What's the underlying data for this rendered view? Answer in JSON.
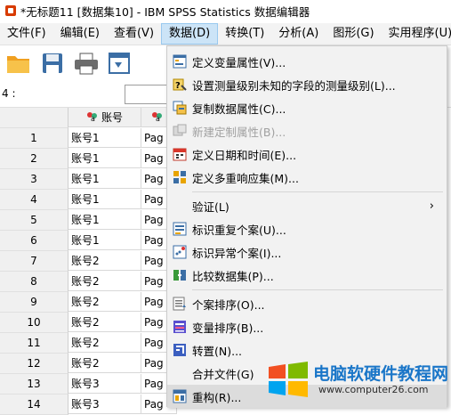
{
  "window": {
    "title": "*无标题11 [数据集10] - IBM SPSS Statistics 数据编辑器"
  },
  "menubar": {
    "items": [
      {
        "label": "文件(F)"
      },
      {
        "label": "编辑(E)"
      },
      {
        "label": "查看(V)"
      },
      {
        "label": "数据(D)"
      },
      {
        "label": "转换(T)"
      },
      {
        "label": "分析(A)"
      },
      {
        "label": "图形(G)"
      },
      {
        "label": "实用程序(U)"
      }
    ]
  },
  "varrow": {
    "label": "4 :"
  },
  "grid": {
    "columns": [
      "账号",
      "a"
    ],
    "rows": [
      {
        "num": "1",
        "c1": "账号1",
        "c2": "Pag"
      },
      {
        "num": "2",
        "c1": "账号1",
        "c2": "Pag"
      },
      {
        "num": "3",
        "c1": "账号1",
        "c2": "Pag"
      },
      {
        "num": "4",
        "c1": "账号1",
        "c2": "Pag"
      },
      {
        "num": "5",
        "c1": "账号1",
        "c2": "Pag"
      },
      {
        "num": "6",
        "c1": "账号1",
        "c2": "Pag"
      },
      {
        "num": "7",
        "c1": "账号2",
        "c2": "Pag"
      },
      {
        "num": "8",
        "c1": "账号2",
        "c2": "Pag"
      },
      {
        "num": "9",
        "c1": "账号2",
        "c2": "Pag"
      },
      {
        "num": "10",
        "c1": "账号2",
        "c2": "Pag"
      },
      {
        "num": "11",
        "c1": "账号2",
        "c2": "Pag"
      },
      {
        "num": "12",
        "c1": "账号2",
        "c2": "Pag"
      },
      {
        "num": "13",
        "c1": "账号3",
        "c2": "Pag"
      },
      {
        "num": "14",
        "c1": "账号3",
        "c2": "Pag"
      }
    ]
  },
  "dropdown": {
    "items": [
      {
        "label": "定义变量属性(V)...",
        "icon": "define-variable-properties-icon"
      },
      {
        "label": "设置测量级别未知的字段的测量级别(L)...",
        "icon": "measurement-level-icon"
      },
      {
        "label": "复制数据属性(C)...",
        "icon": "copy-data-properties-icon"
      },
      {
        "label": "新建定制属性(B)...",
        "icon": "custom-attribute-icon",
        "disabled": true
      },
      {
        "label": "定义日期和时间(E)...",
        "icon": "calendar-icon"
      },
      {
        "label": "定义多重响应集(M)...",
        "icon": "multiple-response-icon"
      },
      {
        "label": "验证(L)",
        "arrow": "›"
      },
      {
        "label": "标识重复个案(U)...",
        "icon": "duplicate-cases-icon"
      },
      {
        "label": "标识异常个案(I)...",
        "icon": "unusual-cases-icon"
      },
      {
        "label": "比较数据集(P)...",
        "icon": "compare-datasets-icon"
      },
      {
        "label": "个案排序(O)...",
        "icon": "sort-cases-icon"
      },
      {
        "label": "变量排序(B)...",
        "icon": "sort-variables-icon"
      },
      {
        "label": "转置(N)...",
        "icon": "transpose-icon"
      },
      {
        "label": "合并文件(G)"
      },
      {
        "label": "重构(R)...",
        "icon": "restructure-icon"
      }
    ]
  },
  "watermark": {
    "brand": "电脑软硬件教程网",
    "url": "www.computer26.com"
  }
}
